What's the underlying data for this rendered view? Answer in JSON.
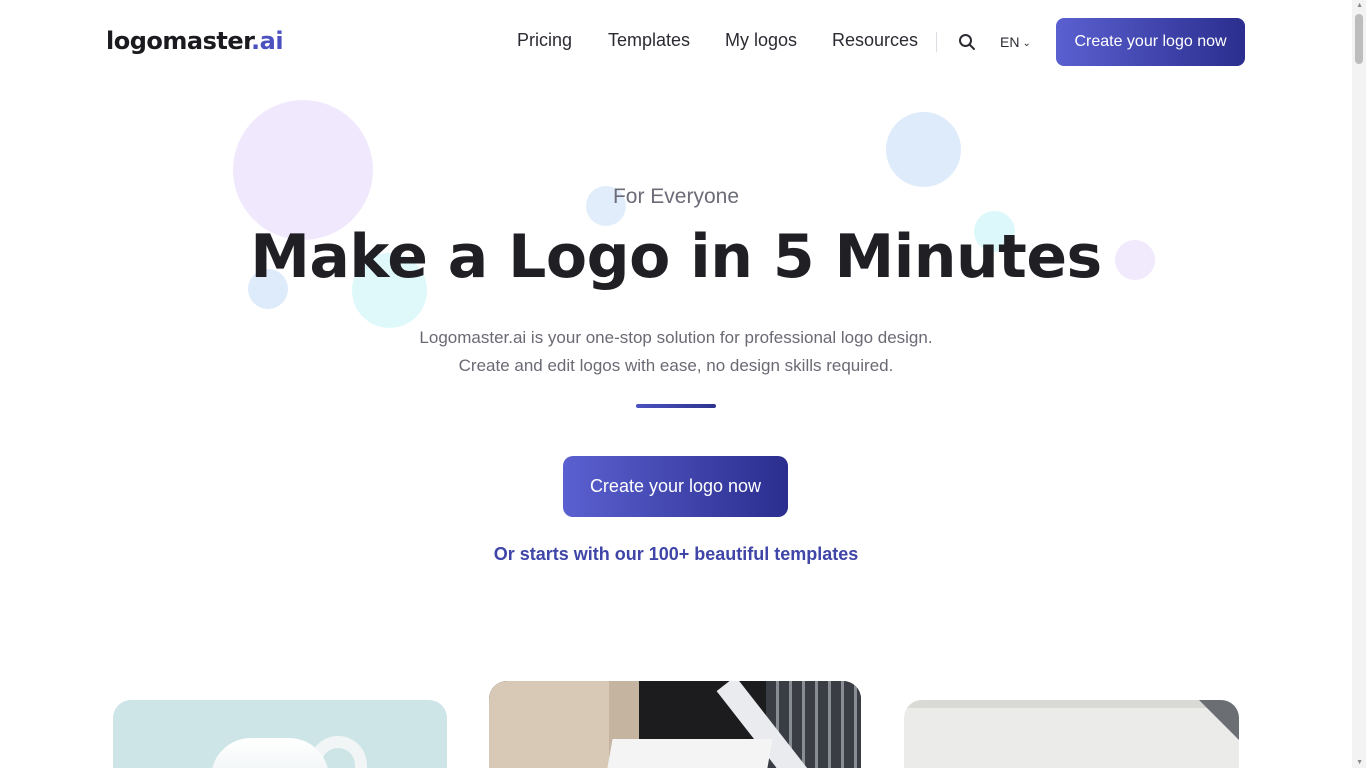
{
  "header": {
    "logo_main": "logomaster",
    "logo_accent": ".ai",
    "nav": [
      {
        "label": "Pricing"
      },
      {
        "label": "Templates"
      },
      {
        "label": "My logos"
      },
      {
        "label": "Resources"
      }
    ],
    "language": "EN",
    "cta_label": "Create your logo now"
  },
  "hero": {
    "eyebrow": "For Everyone",
    "headline": "Make a Logo in 5 Minutes",
    "subtitle_line1": "Logomaster.ai is your one-stop solution for professional logo design.",
    "subtitle_line2": "Create and edit logos with ease, no design skills required.",
    "cta_label": "Create your logo now",
    "templates_link": "Or starts with our 100+ beautiful templates"
  },
  "colors": {
    "brand_accent": "#4b52c0",
    "cta_gradient_start": "#5a60d0",
    "cta_gradient_end": "#2b2e8e",
    "circle_lavender": "#efe6fb",
    "circle_blue": "#dcebfb",
    "circle_cyan": "#dcf8fa"
  },
  "icons": {
    "search": "search-icon",
    "language_dropdown": "chevron-down-icon"
  }
}
